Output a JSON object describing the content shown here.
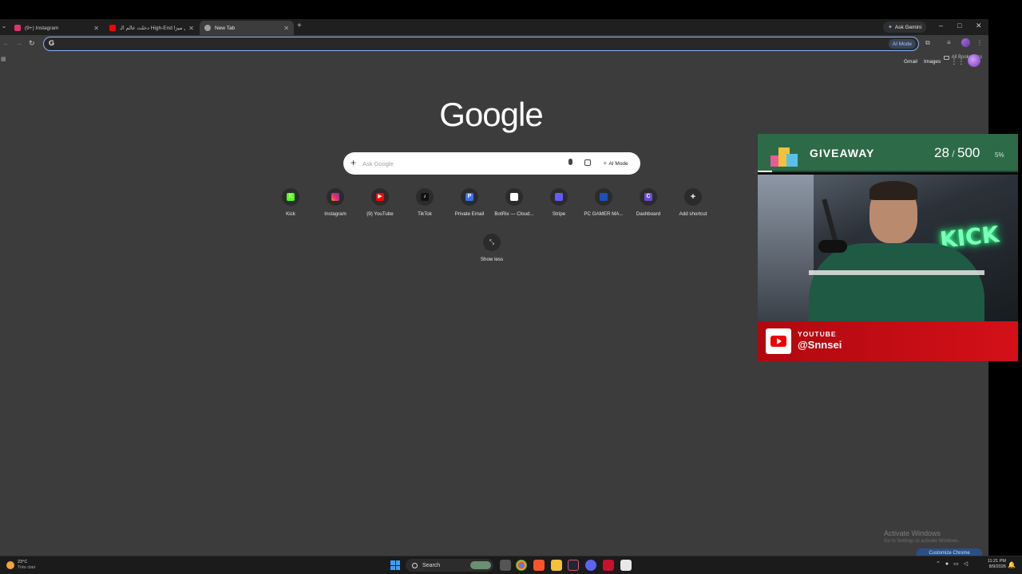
{
  "tabs": [
    {
      "label": "(9+) Instagram",
      "color": "#e1306c"
    },
    {
      "label": "دخلت عالم الـ High-End في ميزا...",
      "color": "#ff0000"
    },
    {
      "label": "New Tab",
      "color": "#9aa0a6"
    }
  ],
  "window": {
    "ask_gemini": "Ask Gemini",
    "minimize": "–",
    "maximize": "□",
    "close": "✕",
    "new_tab": "+"
  },
  "toolbar": {
    "back": "←",
    "forward": "→",
    "reload": "↻",
    "omnibox_g": "G",
    "omnibox_value": "",
    "ai_mode": "AI Mode"
  },
  "bookmarks": {
    "all_bookmarks": "All Bookmarks"
  },
  "ntp": {
    "top_links": {
      "gmail": "Gmail",
      "images": "Images"
    },
    "logo": "Google",
    "search_placeholder": "Ask Google",
    "ai_mode": "AI Mode",
    "shortcuts": [
      {
        "label": "Kick",
        "icon": "kick-icon",
        "color": "#53fc18",
        "glyph": "K"
      },
      {
        "label": "Instagram",
        "icon": "instagram-icon",
        "color": "#d6249f",
        "glyph": ""
      },
      {
        "label": "(9) YouTube",
        "icon": "youtube-icon",
        "color": "#ff0000",
        "glyph": "▶"
      },
      {
        "label": "TikTok",
        "icon": "tiktok-icon",
        "color": "#111111",
        "glyph": "♪"
      },
      {
        "label": "Private Email",
        "icon": "private-email-icon",
        "color": "#3b6ff0",
        "glyph": "P"
      },
      {
        "label": "BotRix — Cloud...",
        "icon": "botrix-icon",
        "color": "#ffffff",
        "glyph": ""
      },
      {
        "label": "Stripe",
        "icon": "stripe-icon",
        "color": "#635bff",
        "glyph": ""
      },
      {
        "label": "PC GAMER MA...",
        "icon": "pc-gamer-icon",
        "color": "#1d4fb8",
        "glyph": ""
      },
      {
        "label": "Dashboard",
        "icon": "dashboard-icon",
        "color": "#6a4cd6",
        "glyph": "C"
      },
      {
        "label": "Add shortcut",
        "icon": "plus-icon",
        "color": "#2b2b2b",
        "glyph": "+"
      }
    ],
    "show_less": "Show less"
  },
  "overlay": {
    "giveaway_title": "GIVEAWAY",
    "count_current": "28",
    "count_total": "500",
    "percent": "5%",
    "progress_fraction": 0.056,
    "youtube_label": "YOUTUBE",
    "youtube_handle": "@Snnsei",
    "neon_sign": "KICK"
  },
  "watermark": {
    "title": "Activate Windows",
    "subtitle": "Go to Settings to activate Windows.",
    "customize": "Customize Chrome"
  },
  "taskbar": {
    "weather_temp": "23°C",
    "weather_desc": "Très clair",
    "search": "Search",
    "time": "11:21 PM",
    "date": "8/9/2026"
  }
}
